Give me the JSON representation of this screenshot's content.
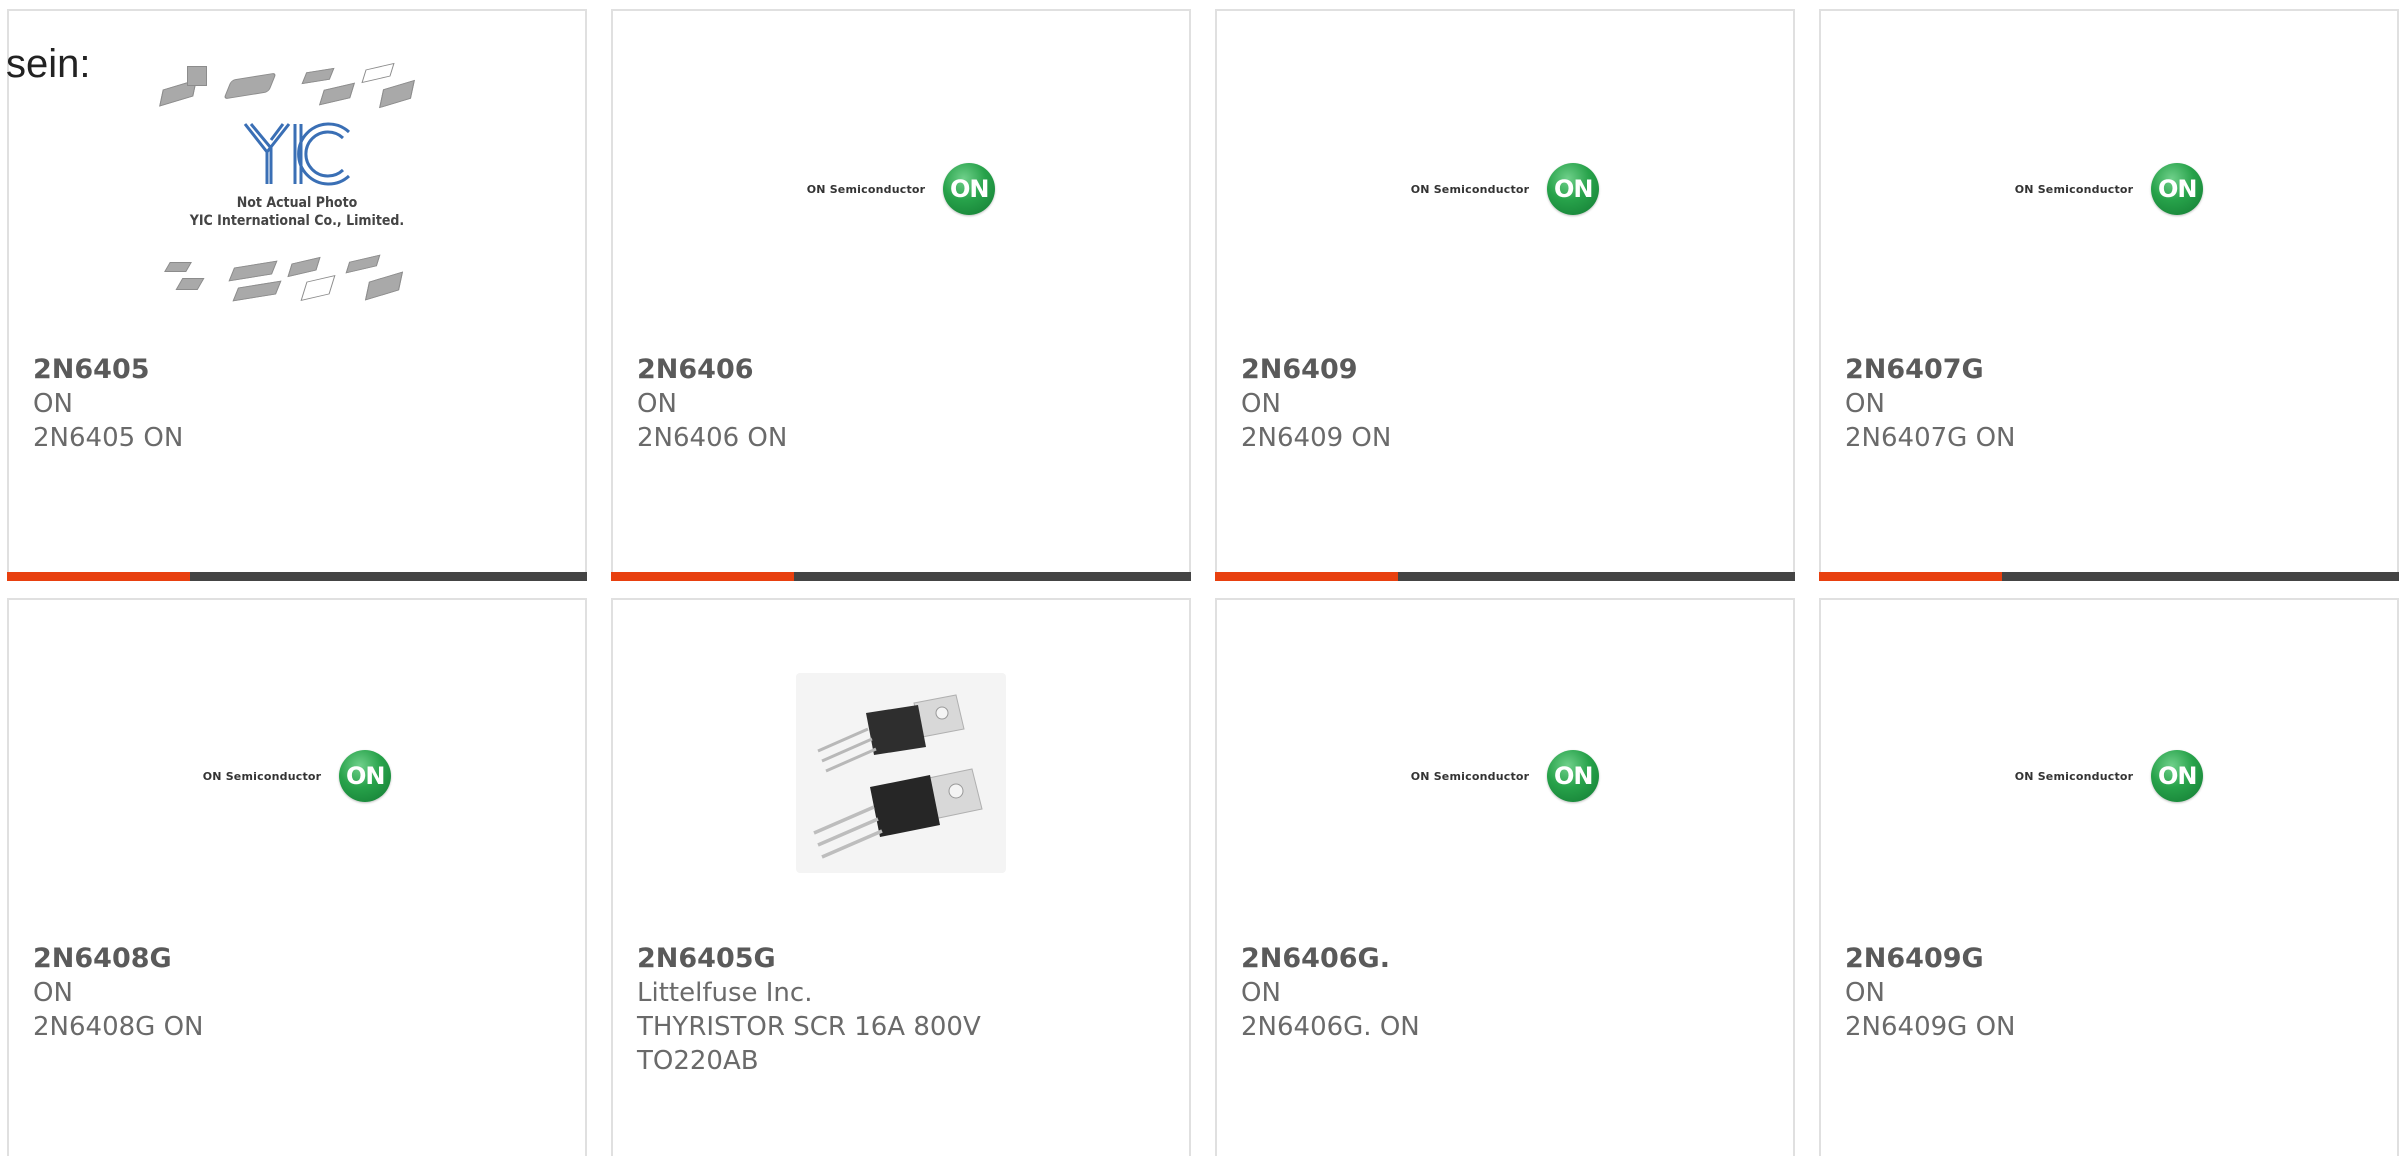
{
  "page_label": "sein:",
  "colors": {
    "accent": "#e8400f",
    "bar": "#444444",
    "on_green": "#27a24a"
  },
  "on_logo": {
    "wordmark": "ON Semiconductor",
    "badge": "ON"
  },
  "yic_placeholder": {
    "mark": "YIC",
    "caption_line1": "Not Actual Photo",
    "caption_line2": "YIC International Co., Limited."
  },
  "products": [
    {
      "part": "2N6405",
      "manufacturer": "ON",
      "description": "2N6405 ON",
      "image": "yic-placeholder"
    },
    {
      "part": "2N6406",
      "manufacturer": "ON",
      "description": "2N6406 ON",
      "image": "on-semiconductor-logo"
    },
    {
      "part": "2N6409",
      "manufacturer": "ON",
      "description": "2N6409 ON",
      "image": "on-semiconductor-logo"
    },
    {
      "part": "2N6407G",
      "manufacturer": "ON",
      "description": "2N6407G ON",
      "image": "on-semiconductor-logo"
    },
    {
      "part": "2N6408G",
      "manufacturer": "ON",
      "description": "2N6408G ON",
      "image": "on-semiconductor-logo"
    },
    {
      "part": "2N6405G",
      "manufacturer": "Littelfuse Inc.",
      "description": "THYRISTOR SCR 16A 800V TO220AB",
      "image": "to220-photo"
    },
    {
      "part": "2N6406G.",
      "manufacturer": "ON",
      "description": "2N6406G. ON",
      "image": "on-semiconductor-logo"
    },
    {
      "part": "2N6409G",
      "manufacturer": "ON",
      "description": "2N6409G ON",
      "image": "on-semiconductor-logo"
    }
  ]
}
